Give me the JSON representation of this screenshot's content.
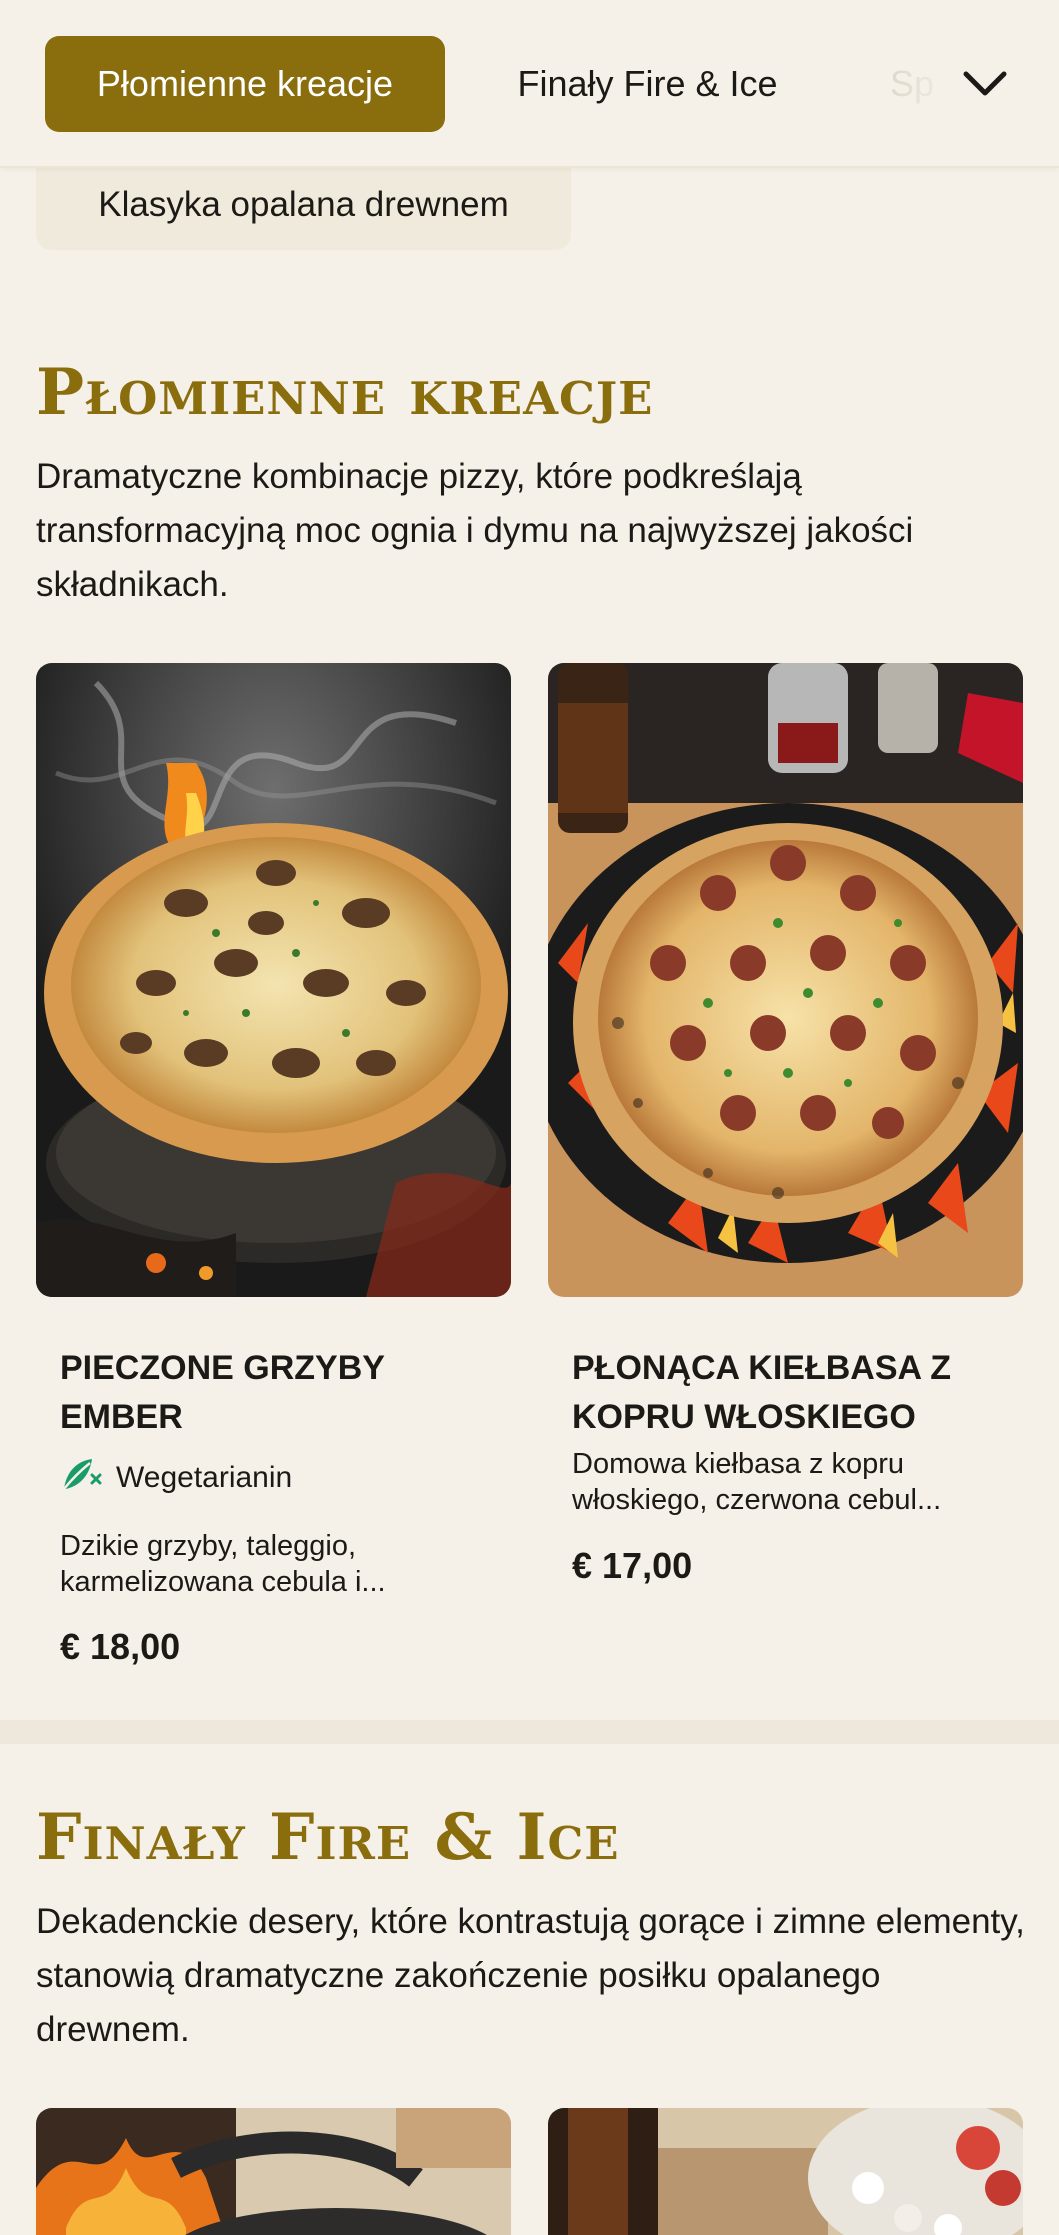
{
  "nav": {
    "active": "Płomienne kreacje",
    "tab2": "Finały Fire & Ice",
    "tab3_partial": "Sp",
    "more_icon": "chevron-down-icon",
    "below_chip": "Klasyka opalana drewnem"
  },
  "sections": [
    {
      "title": "Płomienne kreacje",
      "description": "Dramatyczne kombinacje pizzy, które podkreślają transformacyjną moc ognia i dymu na najwyższej jakości składnikach.",
      "items": [
        {
          "name": "PIECZONE GRZYBY EMBER",
          "badge": "Wegetarianin",
          "badge_icon": "vegetarian-leaf-icon",
          "description": "Dzikie grzyby, taleggio, karmelizowana cebula i...",
          "price": "€ 18,00"
        },
        {
          "name": "PŁONĄCA KIEŁBASA Z KOPRU WŁOSKIEGO",
          "description": "Domowa kiełbasa z kopru włoskiego, czerwona cebul...",
          "price": "€ 17,00"
        }
      ]
    },
    {
      "title": "Finały Fire & Ice",
      "description": "Dekadenckie desery, które kontrastują gorące i zimne elementy, stanowią dramatyczne zakończenie posiłku opalanego drewnem."
    }
  ],
  "colors": {
    "accent": "#8a6d0c",
    "background": "#f5f1e8",
    "badge_green": "#1a9b6a"
  }
}
